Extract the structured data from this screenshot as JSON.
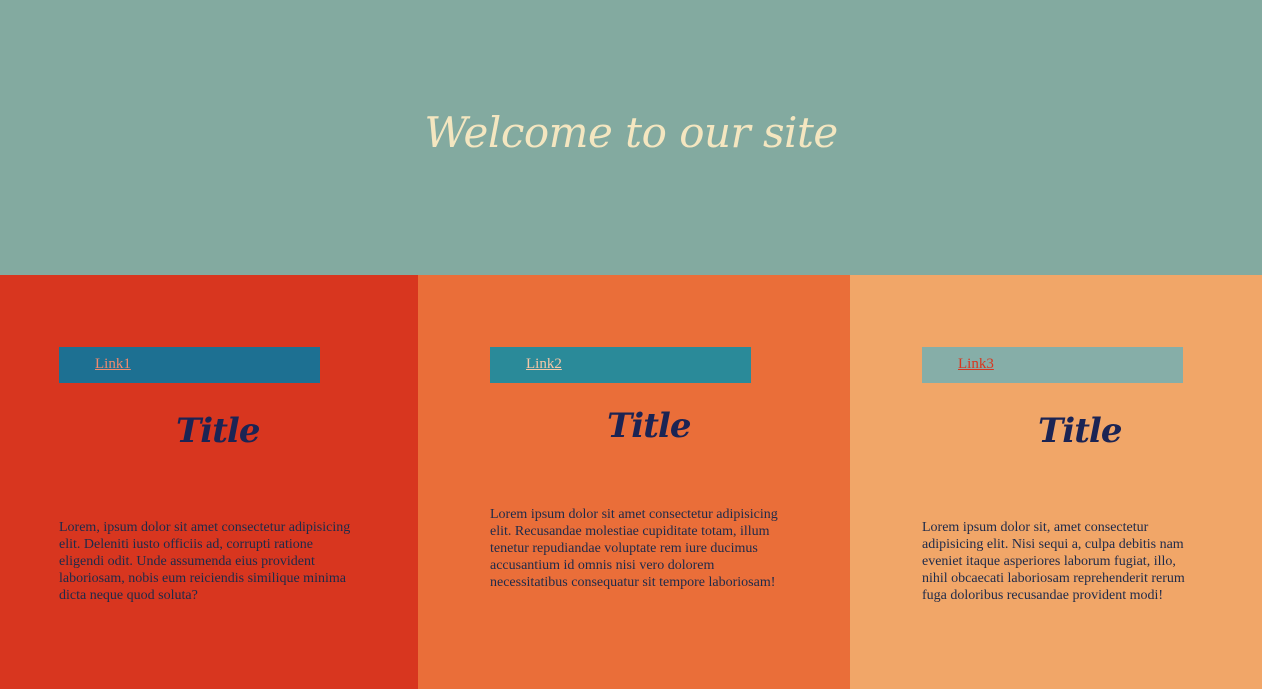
{
  "hero": {
    "title": "Welcome to our site",
    "background": "#83aaa0"
  },
  "columns": [
    {
      "background": "#d8361f",
      "link_label": "Link1",
      "title": "Title",
      "body": "Lorem, ipsum dolor sit amet consectetur adipisicing elit. Deleniti iusto officiis ad, corrupti ratione eligendi odit. Unde assumenda eius provident laboriosam, nobis eum reiciendis similique minima dicta neque quod soluta?"
    },
    {
      "background": "#ea6e39",
      "link_label": "Link2",
      "title": "Title",
      "body": "Lorem ipsum dolor sit amet consectetur adipisicing elit. Recusandae molestiae cupiditate totam, illum tenetur repudiandae voluptate rem iure ducimus accusantium id omnis nisi vero dolorem necessitatibus consequatur sit tempore laboriosam!"
    },
    {
      "background": "#f1a668",
      "link_label": "Link3",
      "title": "Title",
      "body": "Lorem ipsum dolor sit, amet consectetur adipisicing elit. Nisi sequi a, culpa debitis nam eveniet itaque asperiores laborum fugiat, illo, nihil obcaecati laboriosam reprehenderit rerum fuga doloribus recusandae provident modi!"
    }
  ]
}
